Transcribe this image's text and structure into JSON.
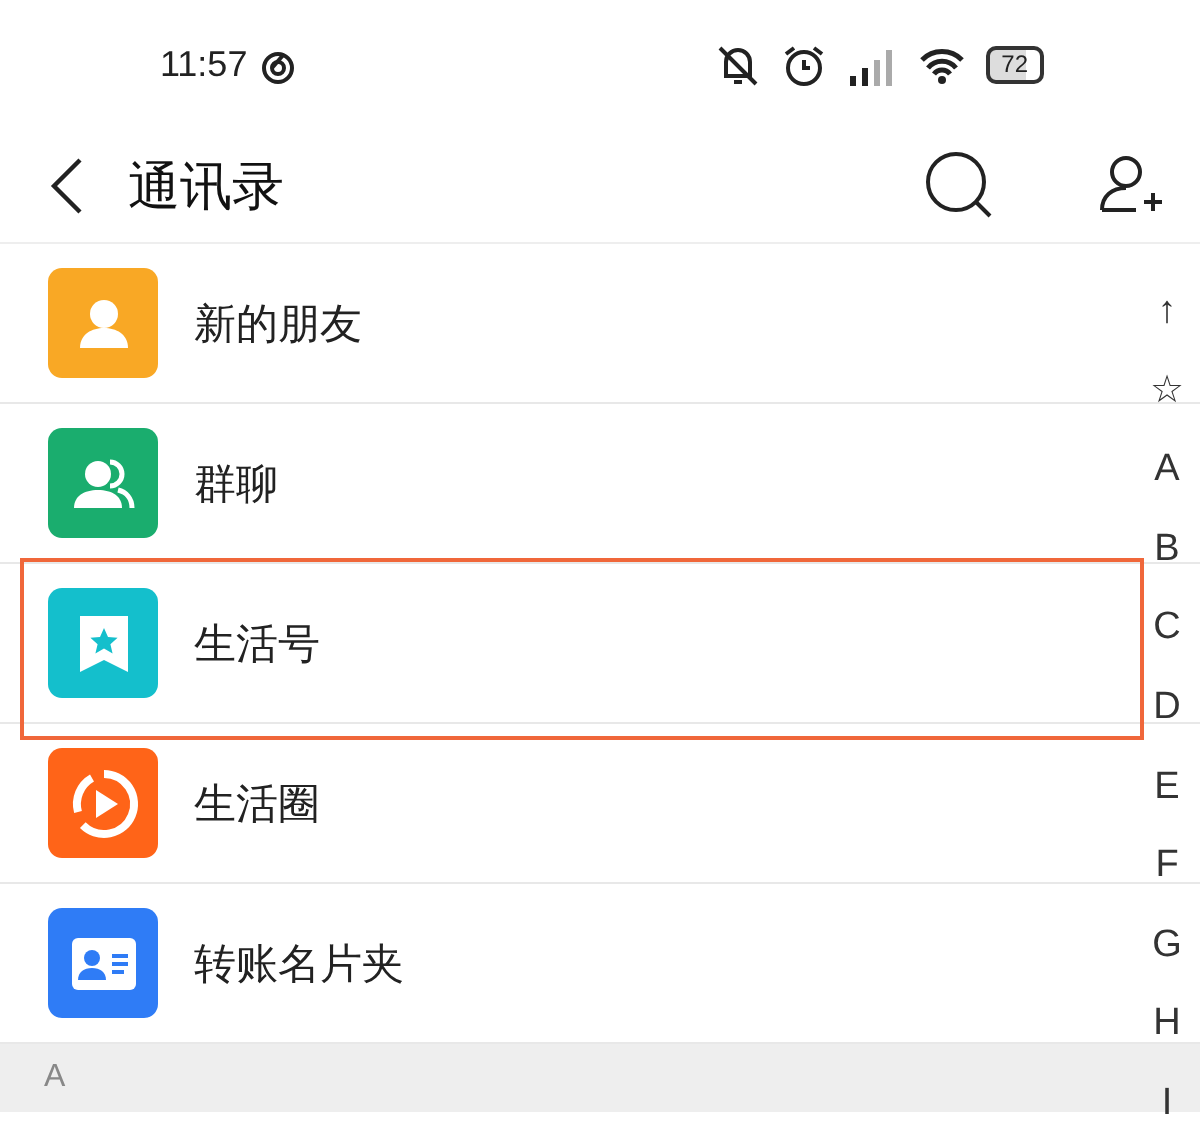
{
  "status_bar": {
    "time": "11:57",
    "battery": "72"
  },
  "header": {
    "title": "通讯录"
  },
  "items": [
    {
      "label": "新的朋友",
      "kind": "new-friends",
      "color": "#f9a825",
      "highlighted": false
    },
    {
      "label": "群聊",
      "kind": "group-chat",
      "color": "#1aad6e",
      "highlighted": false
    },
    {
      "label": "生活号",
      "kind": "life-account",
      "color": "#14bfcc",
      "highlighted": true
    },
    {
      "label": "生活圈",
      "kind": "life-circle",
      "color": "#ff6418",
      "highlighted": false
    },
    {
      "label": "转账名片夹",
      "kind": "card-holder",
      "color": "#2f7cf6",
      "highlighted": false
    }
  ],
  "section_header": "A",
  "index": [
    "↑",
    "☆",
    "A",
    "B",
    "C",
    "D",
    "E",
    "F",
    "G",
    "H",
    "I"
  ]
}
